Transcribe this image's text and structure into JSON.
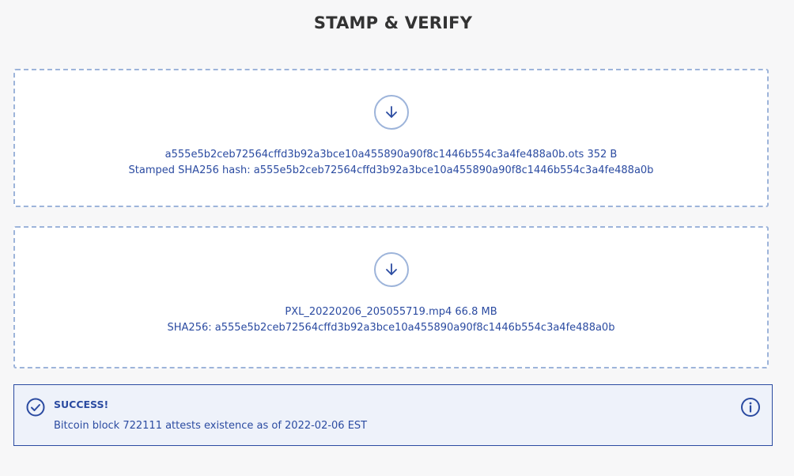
{
  "page": {
    "title": "STAMP & VERIFY"
  },
  "ots_dropzone": {
    "icon": "download-arrow-icon",
    "file_line": "a555e5b2ceb72564cffd3b92a3bce10a455890a90f8c1446b554c3a4fe488a0b.ots 352 B",
    "hash_line": "Stamped SHA256 hash: a555e5b2ceb72564cffd3b92a3bce10a455890a90f8c1446b554c3a4fe488a0b"
  },
  "file_dropzone": {
    "icon": "download-arrow-icon",
    "file_line": "PXL_20220206_205055719.mp4 66.8 MB",
    "hash_line": "SHA256: a555e5b2ceb72564cffd3b92a3bce10a455890a90f8c1446b554c3a4fe488a0b"
  },
  "result": {
    "icon": "check-circle-icon",
    "title": "SUCCESS!",
    "message": "Bitcoin block 722111 attests existence as of 2022-02-06 EST",
    "info_icon": "info-circle-icon"
  },
  "colors": {
    "accent": "#2b4ba1",
    "dashed_border": "#9db4da",
    "alert_bg": "#eef2fa",
    "page_bg": "#f7f7f8",
    "title": "#333333"
  }
}
